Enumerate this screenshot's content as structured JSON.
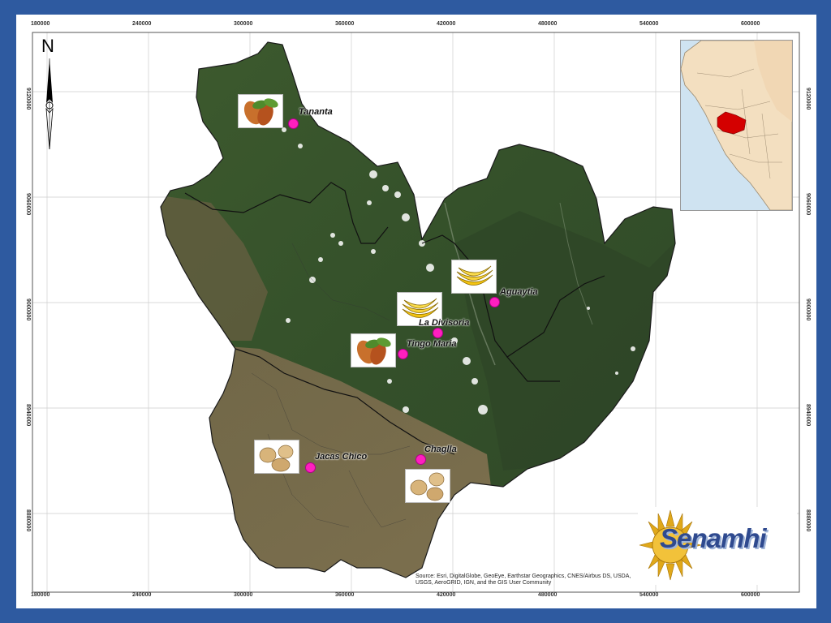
{
  "axis_ticks": {
    "x": [
      "180000",
      "240000",
      "300000",
      "360000",
      "420000",
      "480000",
      "540000",
      "600000"
    ],
    "y": [
      "9120000",
      "9060000",
      "9000000",
      "8940000",
      "8880000"
    ]
  },
  "north_arrow": {
    "letter": "N"
  },
  "places": [
    {
      "name": "Tananta",
      "crop": "cacao"
    },
    {
      "name": "Aguaytia",
      "crop": "banana"
    },
    {
      "name": "La Divisoria",
      "crop": "banana"
    },
    {
      "name": "Tingo Maria",
      "crop": "cacao"
    },
    {
      "name": "Jacas Chico",
      "crop": "potato"
    },
    {
      "name": "Chaglla",
      "crop": "potato"
    }
  ],
  "source_text": "Source: Esri, DigitalGlobe, GeoEye, Earthstar Geographics, CNES/Airbus DS, USDA, USGS, AeroGRID, IGN, and the GIS User Community",
  "logo": {
    "text": "Senamhi"
  },
  "colors": {
    "frame_border": "#2e5aa0",
    "marker": "#ff1fbf",
    "highlight_region": "#d40000",
    "inset_land": "#f3dfc0",
    "inset_sea": "#cfe3f1"
  }
}
